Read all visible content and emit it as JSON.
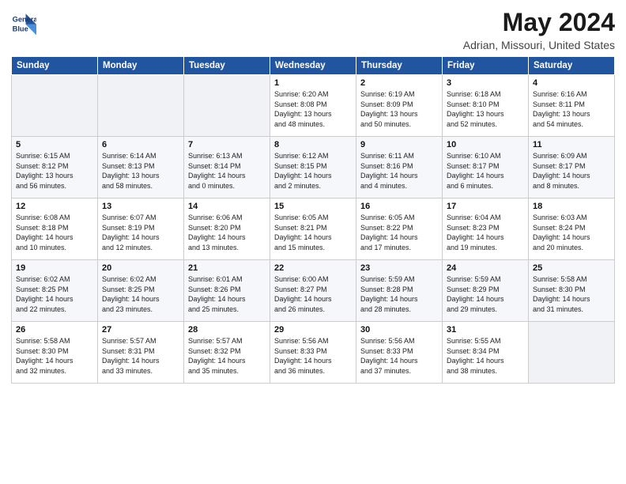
{
  "logo": {
    "text_line1": "General",
    "text_line2": "Blue"
  },
  "title": "May 2024",
  "subtitle": "Adrian, Missouri, United States",
  "days_of_week": [
    "Sunday",
    "Monday",
    "Tuesday",
    "Wednesday",
    "Thursday",
    "Friday",
    "Saturday"
  ],
  "weeks": [
    [
      {
        "day": "",
        "info": ""
      },
      {
        "day": "",
        "info": ""
      },
      {
        "day": "",
        "info": ""
      },
      {
        "day": "1",
        "info": "Sunrise: 6:20 AM\nSunset: 8:08 PM\nDaylight: 13 hours\nand 48 minutes."
      },
      {
        "day": "2",
        "info": "Sunrise: 6:19 AM\nSunset: 8:09 PM\nDaylight: 13 hours\nand 50 minutes."
      },
      {
        "day": "3",
        "info": "Sunrise: 6:18 AM\nSunset: 8:10 PM\nDaylight: 13 hours\nand 52 minutes."
      },
      {
        "day": "4",
        "info": "Sunrise: 6:16 AM\nSunset: 8:11 PM\nDaylight: 13 hours\nand 54 minutes."
      }
    ],
    [
      {
        "day": "5",
        "info": "Sunrise: 6:15 AM\nSunset: 8:12 PM\nDaylight: 13 hours\nand 56 minutes."
      },
      {
        "day": "6",
        "info": "Sunrise: 6:14 AM\nSunset: 8:13 PM\nDaylight: 13 hours\nand 58 minutes."
      },
      {
        "day": "7",
        "info": "Sunrise: 6:13 AM\nSunset: 8:14 PM\nDaylight: 14 hours\nand 0 minutes."
      },
      {
        "day": "8",
        "info": "Sunrise: 6:12 AM\nSunset: 8:15 PM\nDaylight: 14 hours\nand 2 minutes."
      },
      {
        "day": "9",
        "info": "Sunrise: 6:11 AM\nSunset: 8:16 PM\nDaylight: 14 hours\nand 4 minutes."
      },
      {
        "day": "10",
        "info": "Sunrise: 6:10 AM\nSunset: 8:17 PM\nDaylight: 14 hours\nand 6 minutes."
      },
      {
        "day": "11",
        "info": "Sunrise: 6:09 AM\nSunset: 8:17 PM\nDaylight: 14 hours\nand 8 minutes."
      }
    ],
    [
      {
        "day": "12",
        "info": "Sunrise: 6:08 AM\nSunset: 8:18 PM\nDaylight: 14 hours\nand 10 minutes."
      },
      {
        "day": "13",
        "info": "Sunrise: 6:07 AM\nSunset: 8:19 PM\nDaylight: 14 hours\nand 12 minutes."
      },
      {
        "day": "14",
        "info": "Sunrise: 6:06 AM\nSunset: 8:20 PM\nDaylight: 14 hours\nand 13 minutes."
      },
      {
        "day": "15",
        "info": "Sunrise: 6:05 AM\nSunset: 8:21 PM\nDaylight: 14 hours\nand 15 minutes."
      },
      {
        "day": "16",
        "info": "Sunrise: 6:05 AM\nSunset: 8:22 PM\nDaylight: 14 hours\nand 17 minutes."
      },
      {
        "day": "17",
        "info": "Sunrise: 6:04 AM\nSunset: 8:23 PM\nDaylight: 14 hours\nand 19 minutes."
      },
      {
        "day": "18",
        "info": "Sunrise: 6:03 AM\nSunset: 8:24 PM\nDaylight: 14 hours\nand 20 minutes."
      }
    ],
    [
      {
        "day": "19",
        "info": "Sunrise: 6:02 AM\nSunset: 8:25 PM\nDaylight: 14 hours\nand 22 minutes."
      },
      {
        "day": "20",
        "info": "Sunrise: 6:02 AM\nSunset: 8:25 PM\nDaylight: 14 hours\nand 23 minutes."
      },
      {
        "day": "21",
        "info": "Sunrise: 6:01 AM\nSunset: 8:26 PM\nDaylight: 14 hours\nand 25 minutes."
      },
      {
        "day": "22",
        "info": "Sunrise: 6:00 AM\nSunset: 8:27 PM\nDaylight: 14 hours\nand 26 minutes."
      },
      {
        "day": "23",
        "info": "Sunrise: 5:59 AM\nSunset: 8:28 PM\nDaylight: 14 hours\nand 28 minutes."
      },
      {
        "day": "24",
        "info": "Sunrise: 5:59 AM\nSunset: 8:29 PM\nDaylight: 14 hours\nand 29 minutes."
      },
      {
        "day": "25",
        "info": "Sunrise: 5:58 AM\nSunset: 8:30 PM\nDaylight: 14 hours\nand 31 minutes."
      }
    ],
    [
      {
        "day": "26",
        "info": "Sunrise: 5:58 AM\nSunset: 8:30 PM\nDaylight: 14 hours\nand 32 minutes."
      },
      {
        "day": "27",
        "info": "Sunrise: 5:57 AM\nSunset: 8:31 PM\nDaylight: 14 hours\nand 33 minutes."
      },
      {
        "day": "28",
        "info": "Sunrise: 5:57 AM\nSunset: 8:32 PM\nDaylight: 14 hours\nand 35 minutes."
      },
      {
        "day": "29",
        "info": "Sunrise: 5:56 AM\nSunset: 8:33 PM\nDaylight: 14 hours\nand 36 minutes."
      },
      {
        "day": "30",
        "info": "Sunrise: 5:56 AM\nSunset: 8:33 PM\nDaylight: 14 hours\nand 37 minutes."
      },
      {
        "day": "31",
        "info": "Sunrise: 5:55 AM\nSunset: 8:34 PM\nDaylight: 14 hours\nand 38 minutes."
      },
      {
        "day": "",
        "info": ""
      }
    ]
  ]
}
